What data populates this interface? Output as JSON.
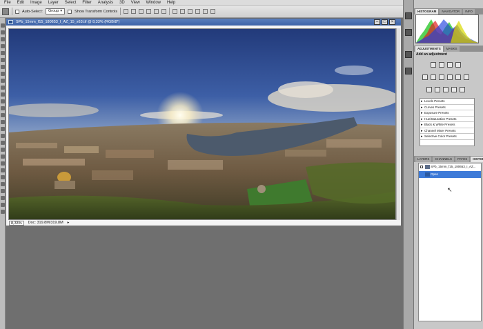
{
  "menu": [
    "File",
    "Edit",
    "Image",
    "Layer",
    "Select",
    "Filter",
    "Analysis",
    "3D",
    "View",
    "Window",
    "Help"
  ],
  "options": {
    "auto_select_label": "Auto-Select:",
    "auto_select_value": "Group",
    "transform_label": "Show Transform Controls"
  },
  "document": {
    "title": "SPb_15mm_f15_180653_I_AZ_15_x63.tif @ 8,33% (RGB/8*)",
    "zoom": "8,33%",
    "doc_size": "Doc: 319.8M/319.8M"
  },
  "panels": {
    "tabs_top": [
      "HISTOGRAM",
      "NAVIGATOR",
      "INFO"
    ],
    "tabs_adj": [
      "ADJUSTMENTS",
      "MASKS"
    ],
    "adj_title": "Add an adjustment",
    "presets": [
      "Levels Presets",
      "Curves Presets",
      "Exposure Presets",
      "Hue/Saturation Presets",
      "Black & White Presets",
      "Channel Mixer Presets",
      "Selective Color Presets"
    ],
    "tabs_hist": [
      "LAYERS",
      "CHANNELS",
      "PATHS",
      "HISTORY"
    ],
    "history": [
      {
        "label": "SPb_15mm_f15_180653_I_AZ...",
        "selected": false
      },
      {
        "label": "Open",
        "selected": true
      }
    ]
  },
  "colors": {
    "title_bar": "#4a70b2",
    "selection": "#3d7ad8"
  }
}
